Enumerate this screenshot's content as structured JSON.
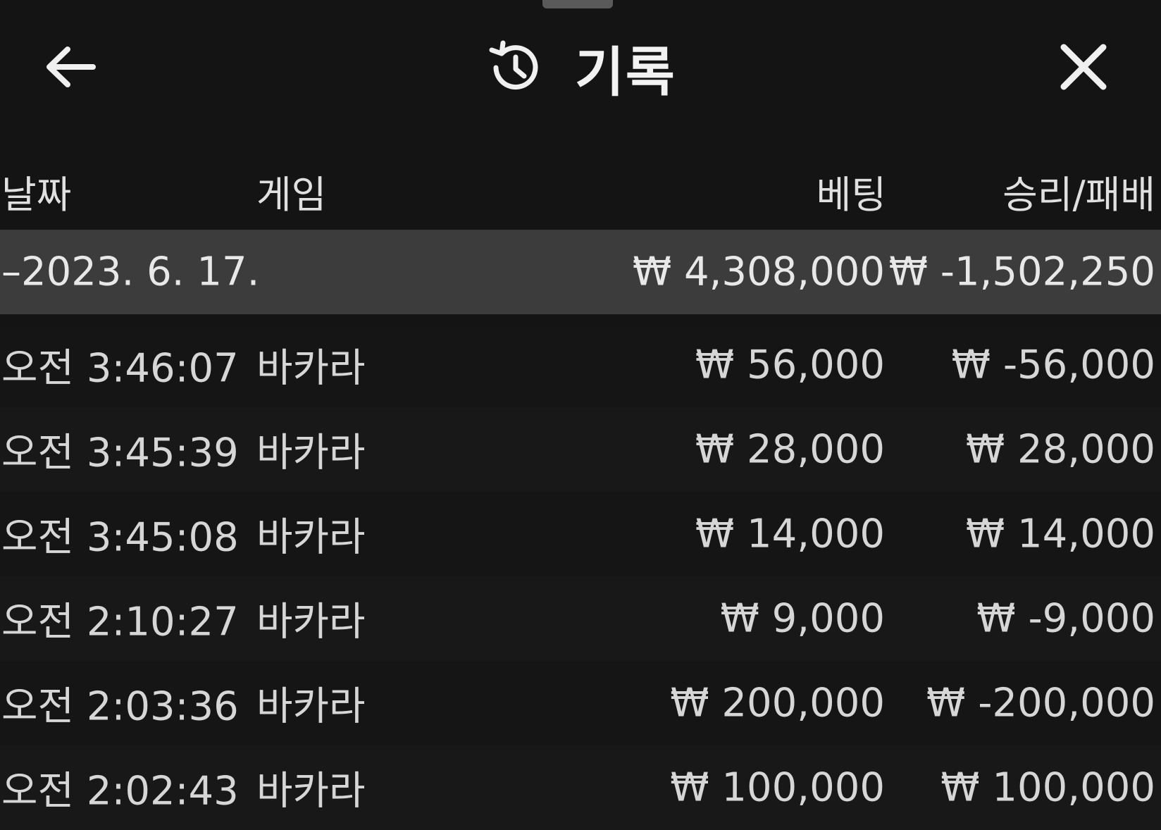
{
  "header": {
    "title": "기록",
    "back_icon": "arrow-left-icon",
    "history_icon": "history-clock-icon",
    "close_icon": "close-icon"
  },
  "columns": {
    "date": "날짜",
    "game": "게임",
    "bet": "베팅",
    "result": "승리/패배"
  },
  "summary": {
    "date": "–2023. 6. 17.",
    "game": "",
    "bet": "₩ 4,308,000",
    "result": "₩ -1,502,250"
  },
  "rows": [
    {
      "time": "오전 3:46:07",
      "game": "바카라",
      "bet": "₩ 56,000",
      "result": "₩ -56,000"
    },
    {
      "time": "오전 3:45:39",
      "game": "바카라",
      "bet": "₩ 28,000",
      "result": "₩ 28,000"
    },
    {
      "time": "오전 3:45:08",
      "game": "바카라",
      "bet": "₩ 14,000",
      "result": "₩ 14,000"
    },
    {
      "time": "오전 2:10:27",
      "game": "바카라",
      "bet": "₩ 9,000",
      "result": "₩ -9,000"
    },
    {
      "time": "오전 2:03:36",
      "game": "바카라",
      "bet": "₩ 200,000",
      "result": "₩ -200,000"
    },
    {
      "time": "오전 2:02:43",
      "game": "바카라",
      "bet": "₩ 100,000",
      "result": "₩ 100,000"
    }
  ],
  "colors": {
    "background": "#141414",
    "summary_background": "#3c3c3c",
    "text": "#d9d9d9",
    "header_text": "#f2f2f2"
  }
}
